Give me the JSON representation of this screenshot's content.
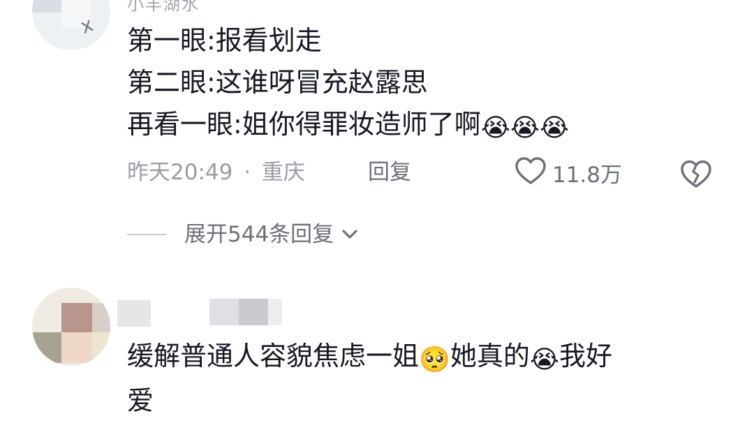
{
  "comment1": {
    "username": "小羊湖水",
    "lines": [
      "第一眼:报看划走",
      "第二眼:这谁呀冒充赵露思",
      "再看一眼:姐你得罪妆造师了啊"
    ],
    "trailing_emojis": [
      "😭",
      "😭",
      "😭"
    ],
    "time": "昨天20:49",
    "separator": "·",
    "location": "重庆",
    "reply_label": "回复",
    "like_count": "11.8万",
    "expand_label": "展开544条回复"
  },
  "comment2": {
    "text_part1": "缓解普通人容貌焦虑一姐",
    "emoji1": "🥺",
    "text_part2": "她真的",
    "emoji2": "😭",
    "text_part3": "我好",
    "text_line2": "爱"
  },
  "icons": {
    "like": "heart-outline-icon",
    "dislike": "broken-heart-icon",
    "expand": "chevron-down-icon"
  },
  "colors": {
    "text_primary": "#161823",
    "text_secondary": "#9a9da6",
    "text_action": "#6d707a"
  }
}
